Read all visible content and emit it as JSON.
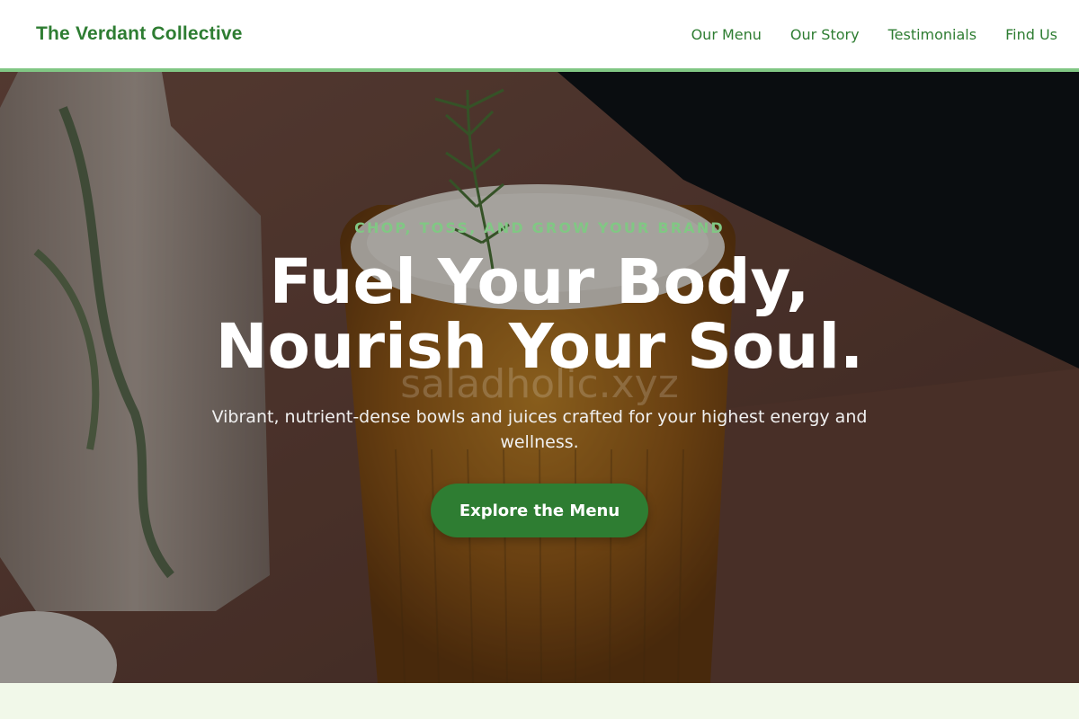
{
  "brand": {
    "name": "The Verdant Collective"
  },
  "nav": {
    "items": [
      {
        "label": "Our Menu"
      },
      {
        "label": "Our Story"
      },
      {
        "label": "Testimonials"
      },
      {
        "label": "Find Us"
      }
    ]
  },
  "hero": {
    "eyebrow": "CHOP, TOSS, AND GROW YOUR BRAND",
    "headline_line1": "Fuel Your Body,",
    "headline_line2": "Nourish Your Soul.",
    "subtext": "Vibrant, nutrient-dense bowls and juices crafted for your highest energy and wellness.",
    "cta_label": "Explore the Menu",
    "watermark": "saladholic.xyz"
  },
  "colors": {
    "brand_green": "#2e7d32",
    "accent_green": "#81c784",
    "section_bg": "#f1f8e9"
  }
}
